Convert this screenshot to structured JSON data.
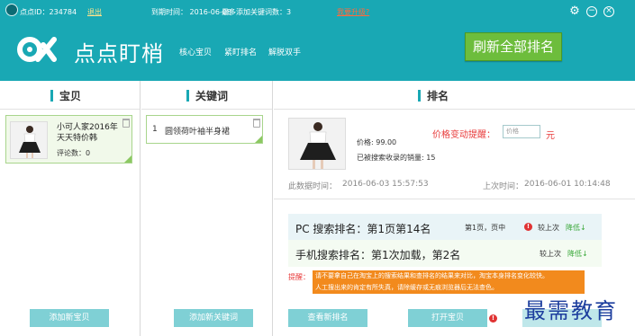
{
  "topbar": {
    "user_id": "点点ID：234784",
    "logout": "退出",
    "expiry": "到期时间： 2016-06-08",
    "max_keywords": "最多添加关键词数：3",
    "upgrade": "我要升级?"
  },
  "header": {
    "brand": "点点盯梢",
    "nav": [
      "核心宝贝",
      "紧盯排名",
      "解脱双手"
    ],
    "refresh_button": "刷新全部排名"
  },
  "columns": {
    "items_title": "宝贝",
    "keywords_title": "关键词",
    "rank_title": "排名"
  },
  "item": {
    "title": "小可人家2016年天天特价韩",
    "reviews": "评论数：0"
  },
  "keyword": {
    "index": "1",
    "text": "圆领荷叶袖半身裙"
  },
  "product": {
    "price": "价格:  99.00",
    "sales": "已被搜索收录的销量:   15",
    "alert_label": "价格变动提醒：",
    "price_placeholder": "价格",
    "unit": "元",
    "data_time_label": "此数据时间：",
    "data_time": "2016-06-03 15:57:53",
    "last_time_label": "上次时间：",
    "last_time": "2016-06-01 10:14:48"
  },
  "rank": {
    "pc_label": "PC  搜索排名：第1页第14名",
    "pc_page": "第1页，页中",
    "pc_compare": "较上次",
    "pc_change": "降低↓",
    "mobile_label": "手机搜索排名：第1次加载，第2名",
    "mobile_compare": "较上次",
    "mobile_change": "降低↓"
  },
  "tips": {
    "label": "提醒：",
    "line1": "请不要拿自己在淘宝上的搜索结果和查排名的结果来对比，淘宝本身排名变化较快。",
    "line2": "人工搜出来的肯定有所失真，请除缓存或无痕浏览器后无法查色。"
  },
  "buttons": {
    "add_item": "添加新宝贝",
    "add_keyword": "添加新关键词",
    "view_rank": "查看新排名",
    "open_item": "打开宝贝"
  },
  "watermark": "最需教育",
  "colors": {
    "brand_teal": "#19a8b4",
    "refresh_green": "#6dbd3c",
    "alert_red": "#e83b3b",
    "tip_orange": "#f28a1d"
  }
}
